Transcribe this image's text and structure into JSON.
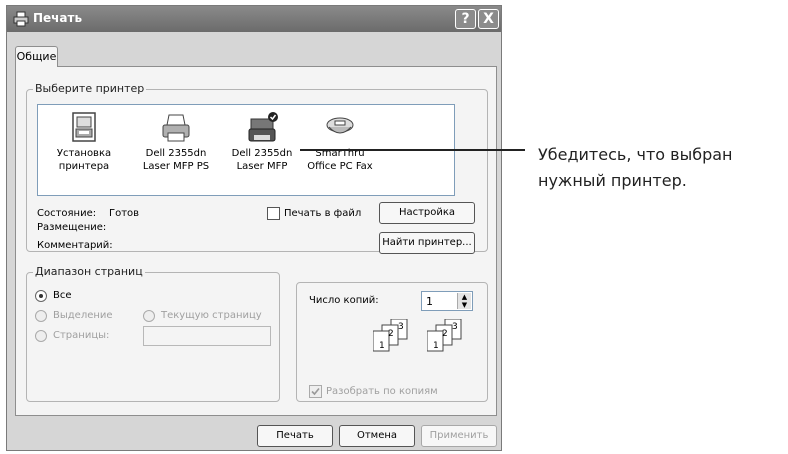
{
  "window": {
    "title": "Печать",
    "help_button": "?",
    "close_button": "X"
  },
  "tabs": [
    {
      "label": "Общие"
    }
  ],
  "printer_group": {
    "label": "Выберите принтер",
    "printers": [
      {
        "line1": "Установка",
        "line2": "принтера",
        "icon": "add-printer-icon",
        "selected": false
      },
      {
        "line1": "Dell 2355dn",
        "line2": "Laser MFP PS",
        "icon": "printer-icon",
        "selected": false
      },
      {
        "line1": "Dell 2355dn",
        "line2": "Laser MFP",
        "icon": "default-printer-icon",
        "selected": true
      },
      {
        "line1": "SmarThru",
        "line2": "Office PC Fax",
        "icon": "fax-icon",
        "selected": false
      }
    ],
    "status_label": "Состояние:",
    "status_value": "Готов",
    "location_label": "Размещение:",
    "location_value": "",
    "comment_label": "Комментарий:",
    "comment_value": "",
    "print_to_file": {
      "label": "Печать в файл",
      "checked": false
    },
    "settings_button": "Настройка",
    "find_printer_button": "Найти принтер..."
  },
  "page_range": {
    "label": "Диапазон страниц",
    "all": "Все",
    "selection": "Выделение",
    "current_page": "Текущую страницу",
    "pages": "Страницы:",
    "pages_value": "",
    "selected": "all"
  },
  "copies": {
    "label": "Число копий:",
    "value": "1",
    "collate": {
      "label": "Разобрать по копиям",
      "checked": true,
      "enabled": false
    },
    "collate_pages": [
      "1",
      "2",
      "3"
    ]
  },
  "buttons": {
    "print": "Печать",
    "cancel": "Отмена",
    "apply": "Применить"
  },
  "annotation": {
    "line1": "Убедитесь, что выбран",
    "line2": "нужный принтер."
  },
  "colors": {
    "titlebar": "#6b6b6b",
    "selection": "#5a5a5a",
    "panel": "#f4f4f4",
    "frame": "#d6d6d6"
  }
}
